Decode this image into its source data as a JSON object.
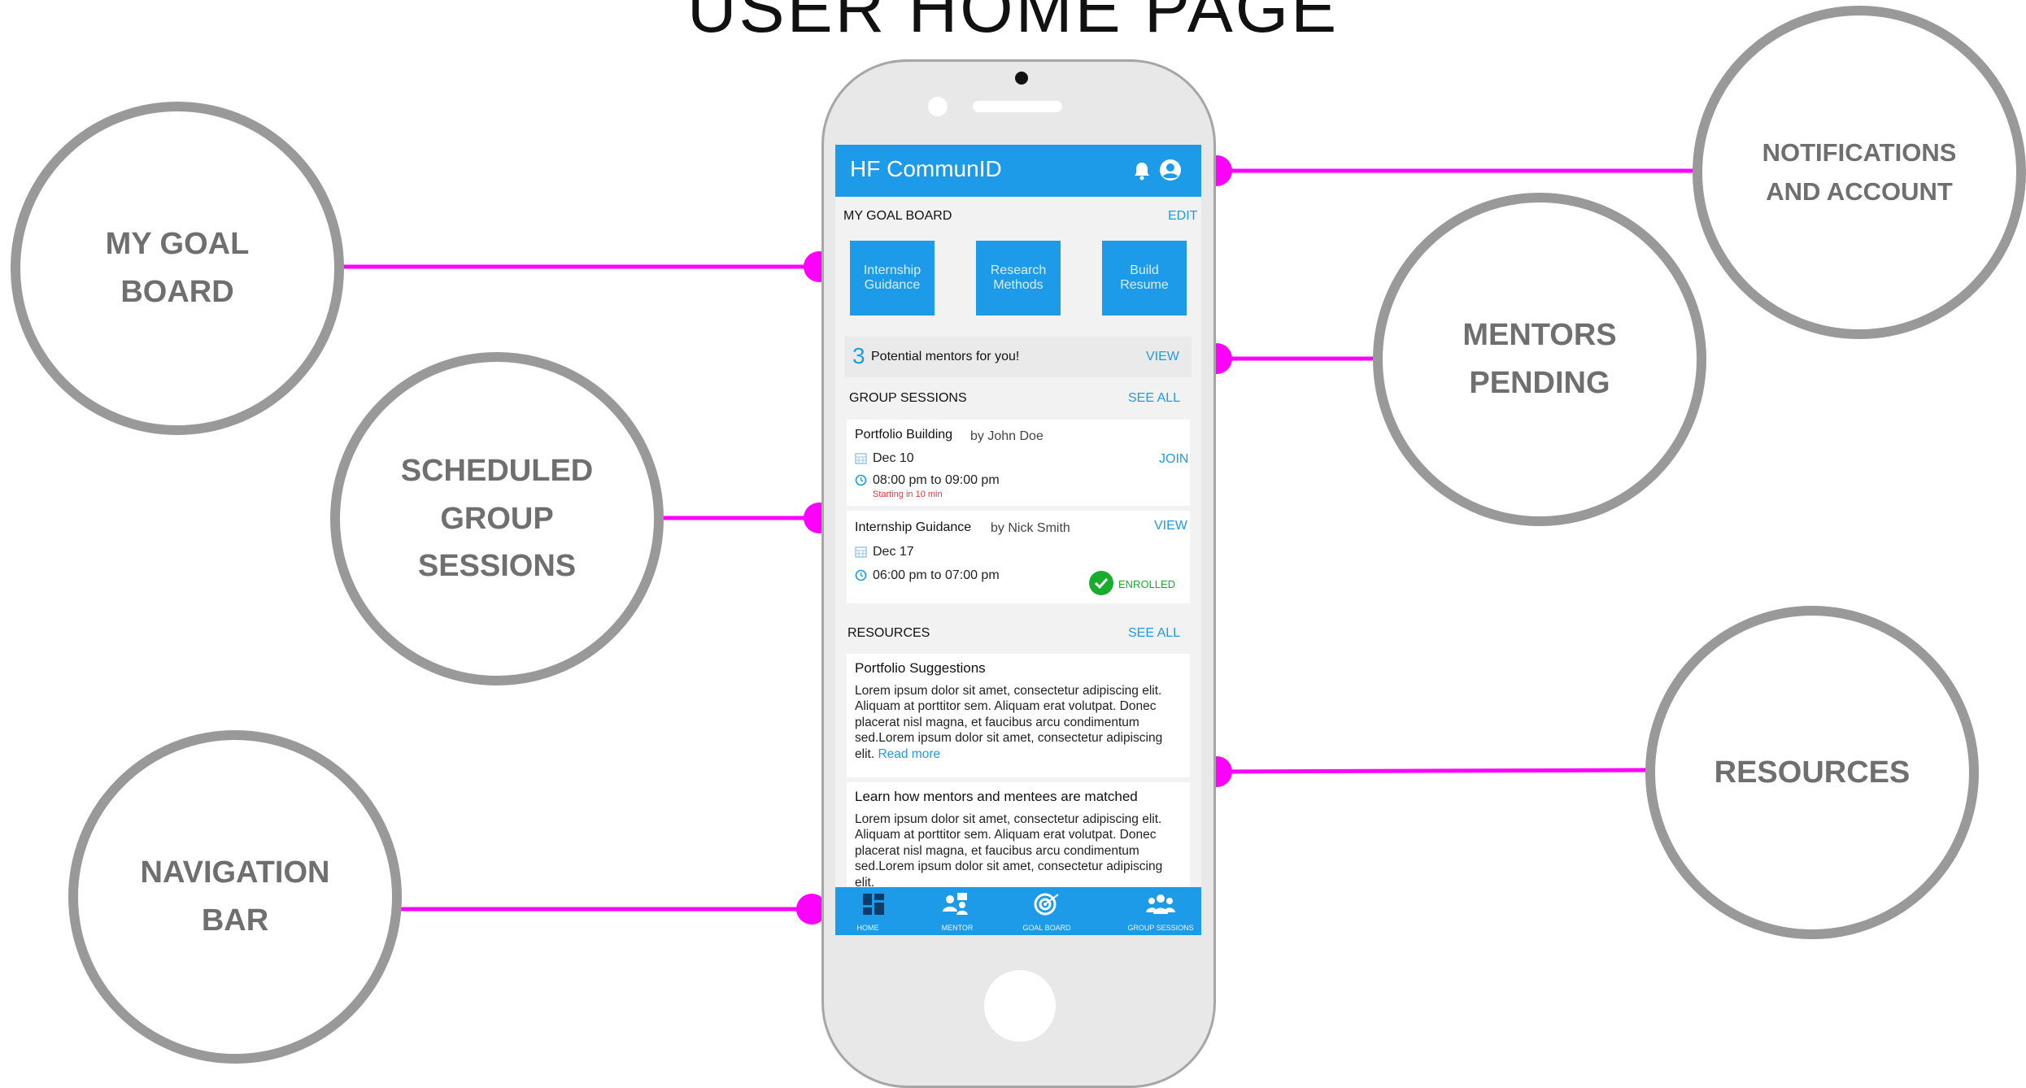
{
  "page_title": "USER HOME PAGE",
  "colors": {
    "accent": "#1e9be8",
    "connector": "#ff00ff",
    "bubble_border": "#999999",
    "enrolled": "#1aac2f",
    "warning": "#e53935"
  },
  "callouts": {
    "my_goal_board": "MY GOAL\nBOARD",
    "scheduled_group_sessions": "SCHEDULED\nGROUP\nSESSIONS",
    "navigation_bar": "NAVIGATION\nBAR",
    "notifications_and_account": "NOTIFICATIONS\nAND ACCOUNT",
    "mentors_pending": "MENTORS\nPENDING",
    "resources": "RESOURCES"
  },
  "app": {
    "title": "HF CommunID",
    "header_icons": [
      "bell-icon",
      "account-icon"
    ],
    "goal_board": {
      "label": "MY GOAL BOARD",
      "edit": "EDIT",
      "tiles": [
        "Internship\nGuidance",
        "Research\nMethods",
        "Build\nResume"
      ]
    },
    "mentors": {
      "count": "3",
      "text": "Potential mentors for you!",
      "action": "VIEW"
    },
    "group_sessions": {
      "label": "GROUP SESSIONS",
      "see_all": "SEE ALL",
      "items": [
        {
          "title": "Portfolio Building",
          "by": "by John Doe",
          "date": "Dec 10",
          "time": "08:00 pm to 09:00 pm",
          "note": "Starting in 10 min",
          "action": "JOIN"
        },
        {
          "title": "Internship Guidance",
          "by": "by Nick Smith",
          "date": "Dec 17",
          "time": "06:00 pm to 07:00 pm",
          "action": "VIEW",
          "status": "ENROLLED"
        }
      ]
    },
    "resources": {
      "label": "RESOURCES",
      "see_all": "SEE ALL",
      "items": [
        {
          "title": "Portfolio Suggestions",
          "body": "Lorem ipsum dolor sit amet, consectetur adipiscing elit. Aliquam at porttitor sem.  Aliquam erat volutpat. Donec placerat nisl magna, et faucibus arcu condimentum sed.Lorem ipsum dolor sit amet, consectetur adipiscing elit.",
          "more": "Read more"
        },
        {
          "title": "Learn how mentors and mentees are matched",
          "body": "Lorem ipsum dolor sit amet, consectetur adipiscing elit. Aliquam at porttitor sem.  Aliquam erat volutpat. Donec placerat nisl magna, et faucibus arcu condimentum sed.Lorem ipsum dolor sit amet, consectetur adipiscing elit."
        }
      ]
    },
    "nav": [
      {
        "label": "HOME",
        "icon": "home-icon"
      },
      {
        "label": "MENTOR",
        "icon": "mentor-icon"
      },
      {
        "label": "GOAL BOARD",
        "icon": "goal-board-icon"
      },
      {
        "label": "GROUP SESSIONS",
        "icon": "group-sessions-icon"
      }
    ]
  }
}
